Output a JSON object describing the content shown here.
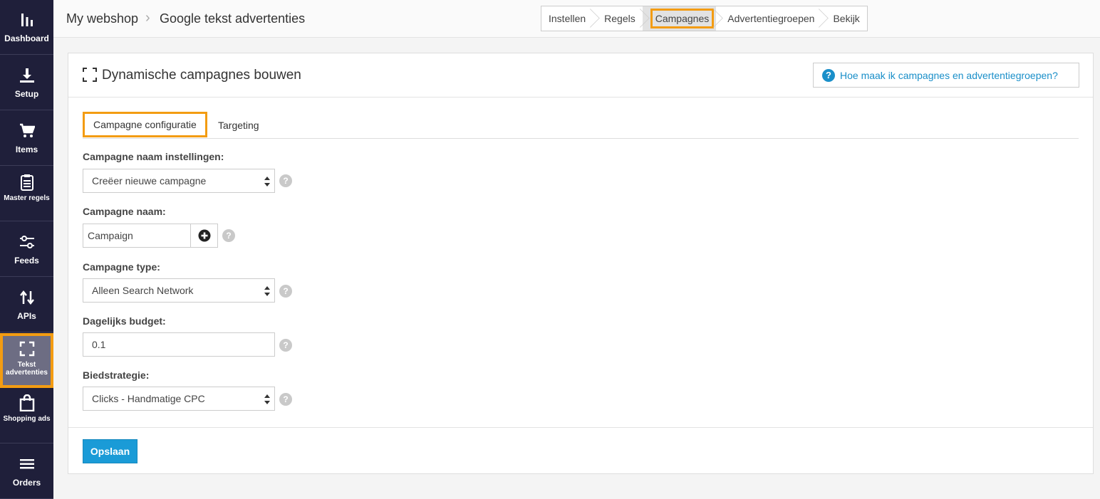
{
  "sidebar": {
    "items": [
      {
        "label": "Dashboard",
        "icon": "bar-chart-icon"
      },
      {
        "label": "Setup",
        "icon": "download-icon"
      },
      {
        "label": "Items",
        "icon": "cart-icon"
      },
      {
        "label": "Master regels",
        "icon": "clipboard-icon"
      },
      {
        "label": "Feeds",
        "icon": "sliders-icon"
      },
      {
        "label": "APIs",
        "icon": "swap-vertical-icon"
      },
      {
        "label": "Tekst advertenties",
        "icon": "fullscreen-icon"
      },
      {
        "label": "Shopping ads",
        "icon": "shopping-bag-icon"
      },
      {
        "label": "Orders",
        "icon": "list-icon"
      }
    ],
    "active_index": 6
  },
  "breadcrumb": {
    "shop": "My webshop",
    "page": "Google tekst advertenties"
  },
  "wizard": {
    "steps": [
      "Instellen",
      "Regels",
      "Campagnes",
      "Advertentiegroepen",
      "Bekijk"
    ],
    "active_index": 2
  },
  "panel": {
    "title": "Dynamische campagnes bouwen",
    "help_link": "Hoe maak ik campagnes en advertentiegroepen?"
  },
  "tabs": [
    {
      "label": "Campagne configuratie",
      "active": true
    },
    {
      "label": "Targeting",
      "active": false
    }
  ],
  "form": {
    "name_settings_label": "Campagne naam instellingen:",
    "name_settings_value": "Creëer nieuwe campagne",
    "name_label": "Campagne naam:",
    "name_value": "Campaign",
    "type_label": "Campagne type:",
    "type_value": "Alleen Search Network",
    "budget_label": "Dagelijks budget:",
    "budget_value": "0.1",
    "bid_label": "Biedstrategie:",
    "bid_value": "Clicks - Handmatige CPC",
    "help_glyph": "?"
  },
  "footer": {
    "save_label": "Opslaan"
  },
  "colors": {
    "sidebar_bg": "#1f1f3a",
    "highlight": "#f39c12",
    "primary": "#1a9bd7",
    "link": "#1a8fc9"
  }
}
